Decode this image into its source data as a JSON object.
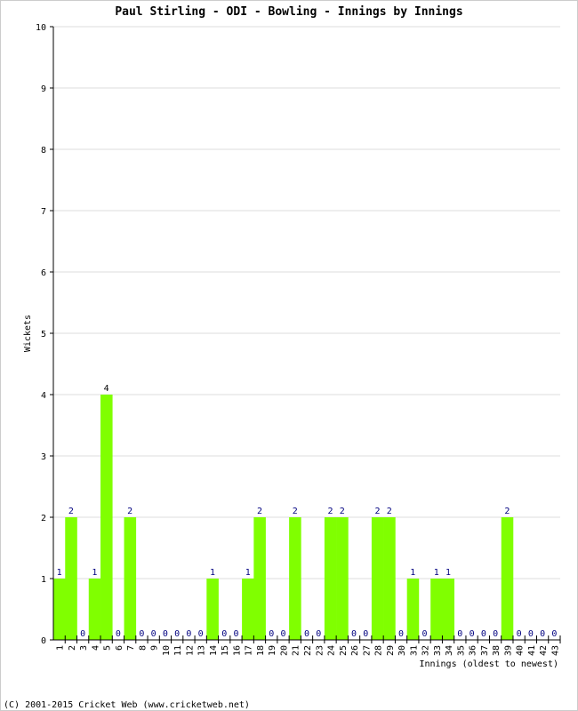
{
  "chart_data": {
    "type": "bar",
    "title": "Paul Stirling - ODI - Bowling - Innings by Innings",
    "xlabel": "Innings (oldest to newest)",
    "ylabel": "Wickets",
    "ylim": [
      0,
      10
    ],
    "yticks": [
      0,
      1,
      2,
      3,
      4,
      5,
      6,
      7,
      8,
      9,
      10
    ],
    "grid": true,
    "categories": [
      "1",
      "2",
      "3",
      "4",
      "5",
      "6",
      "7",
      "8",
      "9",
      "10",
      "11",
      "12",
      "13",
      "14",
      "15",
      "16",
      "17",
      "18",
      "19",
      "20",
      "21",
      "22",
      "23",
      "24",
      "25",
      "26",
      "27",
      "28",
      "29",
      "30",
      "31",
      "32",
      "33",
      "34",
      "35",
      "36",
      "37",
      "38",
      "39",
      "40",
      "41",
      "42",
      "43"
    ],
    "values": [
      1,
      2,
      0,
      1,
      4,
      0,
      2,
      0,
      0,
      0,
      0,
      0,
      0,
      1,
      0,
      0,
      1,
      2,
      0,
      0,
      2,
      0,
      0,
      2,
      2,
      0,
      0,
      2,
      2,
      0,
      1,
      0,
      1,
      1,
      0,
      0,
      0,
      0,
      2,
      0,
      0,
      0,
      0
    ],
    "bar_color": "#80ff00",
    "label_color": "#000080"
  },
  "footer": "(C) 2001-2015 Cricket Web (www.cricketweb.net)"
}
